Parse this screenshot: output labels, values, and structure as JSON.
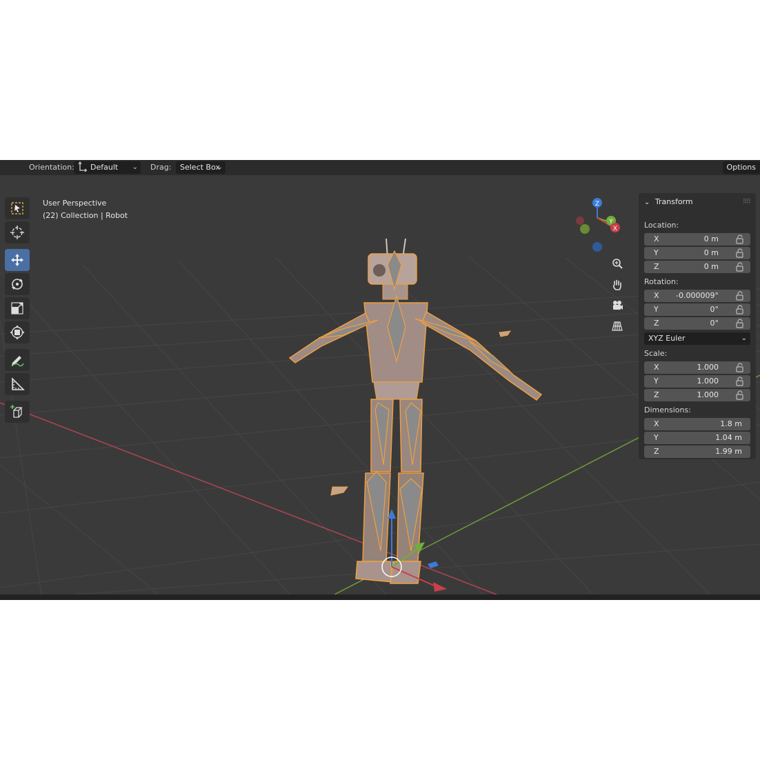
{
  "header": {
    "orientation_label": "Orientation:",
    "orientation_value": "Default",
    "drag_label": "Drag:",
    "drag_value": "Select Box",
    "options_label": "Options"
  },
  "viewport": {
    "view_name": "User Perspective",
    "collection_line": "(22) Collection | Robot"
  },
  "gizmo": {
    "z_label": "Z",
    "y_label": "Y",
    "x_label": "X"
  },
  "toolbar": {
    "tools": [
      "select-box-tool",
      "cursor-tool",
      "move-tool",
      "rotate-tool",
      "scale-tool",
      "transform-tool",
      "annotate-tool",
      "measure-tool",
      "add-cube-tool"
    ],
    "active": "move-tool"
  },
  "panel": {
    "title": "Transform",
    "location_label": "Location:",
    "location": [
      {
        "axis": "X",
        "value": "0 m"
      },
      {
        "axis": "Y",
        "value": "0 m"
      },
      {
        "axis": "Z",
        "value": "0 m"
      }
    ],
    "rotation_label": "Rotation:",
    "rotation": [
      {
        "axis": "X",
        "value": "-0.000009°"
      },
      {
        "axis": "Y",
        "value": "0°"
      },
      {
        "axis": "Z",
        "value": "0°"
      }
    ],
    "rotation_mode": "XYZ Euler",
    "scale_label": "Scale:",
    "scale": [
      {
        "axis": "X",
        "value": "1.000"
      },
      {
        "axis": "Y",
        "value": "1.000"
      },
      {
        "axis": "Z",
        "value": "1.000"
      }
    ],
    "dimensions_label": "Dimensions:",
    "dimensions": [
      {
        "axis": "X",
        "value": "1.8 m"
      },
      {
        "axis": "Y",
        "value": "1.04 m"
      },
      {
        "axis": "Z",
        "value": "1.99 m"
      }
    ]
  },
  "colors": {
    "viewport_bg": "#3a3a3a",
    "active_tool": "#4a6fa5",
    "selection_orange": "#f0a040",
    "axis_x": "#c8404a",
    "axis_y": "#7fa83a",
    "axis_z": "#3d7bd6"
  }
}
